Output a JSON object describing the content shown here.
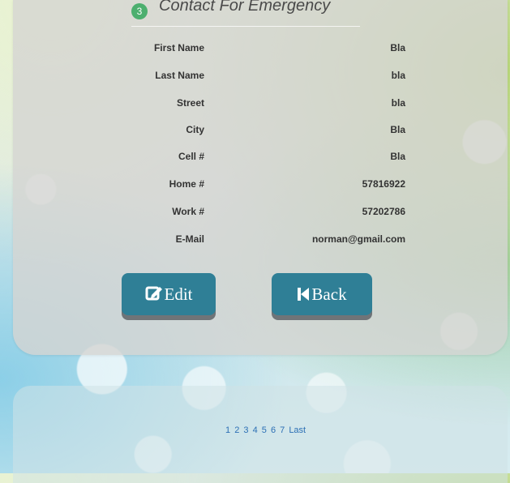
{
  "section": {
    "step": "3",
    "title": "Contact For Emergency"
  },
  "fields": [
    {
      "label": "First Name",
      "value": "Bla"
    },
    {
      "label": "Last Name",
      "value": "bla"
    },
    {
      "label": "Street",
      "value": "bla"
    },
    {
      "label": "City",
      "value": "Bla"
    },
    {
      "label": "Cell #",
      "value": "Bla"
    },
    {
      "label": "Home #",
      "value": "57816922"
    },
    {
      "label": "Work #",
      "value": "57202786"
    },
    {
      "label": "E-Mail",
      "value": "norman@gmail.com"
    }
  ],
  "buttons": {
    "edit": "Edit",
    "back": "Back"
  },
  "pagination": [
    "1",
    "2",
    "3",
    "4",
    "5",
    "6",
    "7",
    "Last"
  ]
}
